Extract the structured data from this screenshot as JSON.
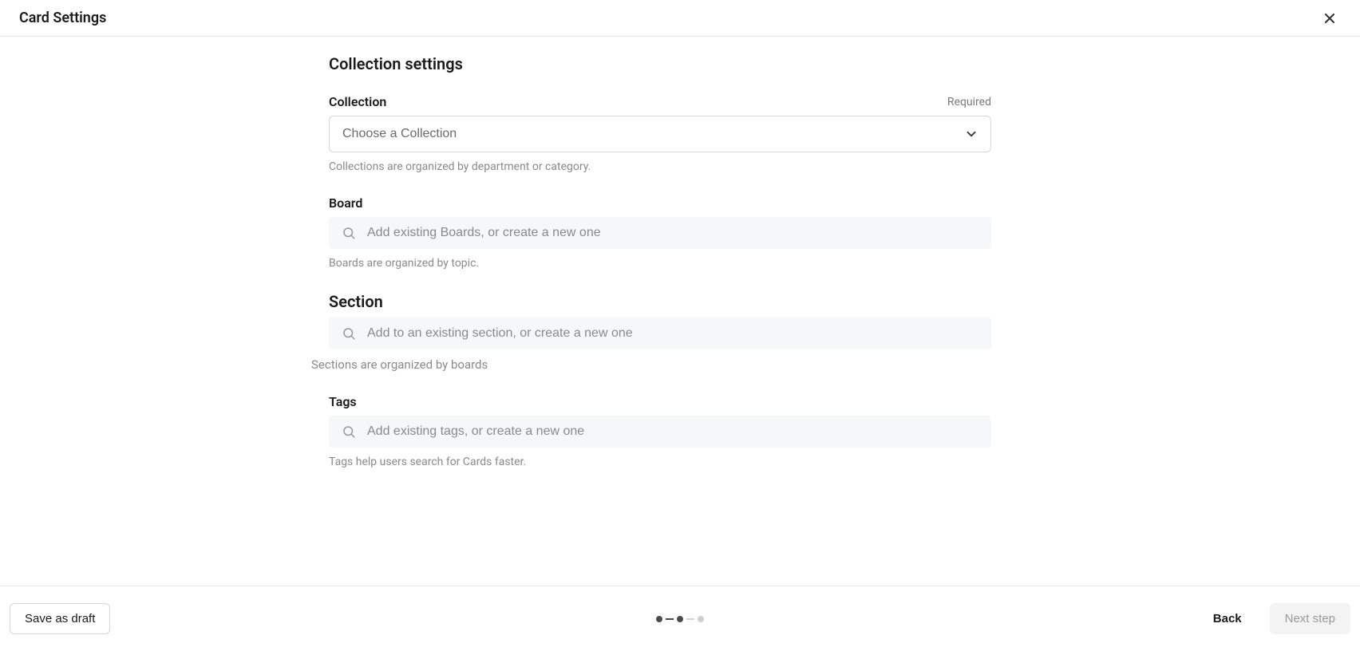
{
  "header": {
    "title": "Card Settings"
  },
  "form": {
    "title": "Collection settings",
    "collection": {
      "label": "Collection",
      "required_label": "Required",
      "placeholder": "Choose a Collection",
      "helper": "Collections are organized by department or category."
    },
    "board": {
      "label": "Board",
      "placeholder": "Add existing Boards, or create a new one",
      "helper": "Boards are organized by topic."
    },
    "section": {
      "label": "Section",
      "placeholder": "Add to an existing section, or create a new one",
      "helper": "Sections are organized by boards"
    },
    "tags": {
      "label": "Tags",
      "placeholder": "Add existing tags, or create a new one",
      "helper": "Tags help users search for Cards faster."
    }
  },
  "footer": {
    "save_draft": "Save as draft",
    "back": "Back",
    "next": "Next step"
  }
}
